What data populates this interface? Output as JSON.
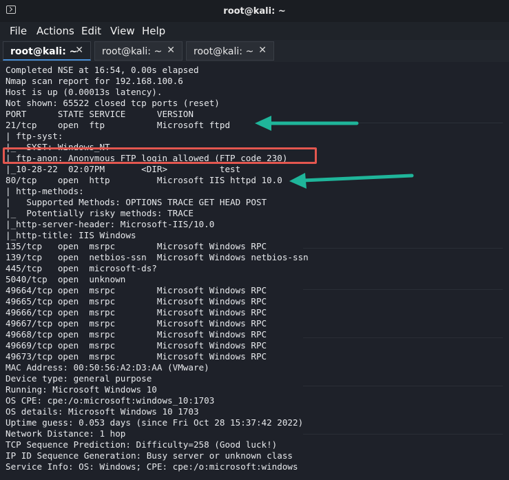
{
  "window": {
    "title": "root@kali: ~",
    "icon": "terminal-icon"
  },
  "menu": [
    "File",
    "Actions",
    "Edit",
    "View",
    "Help"
  ],
  "tabs": [
    {
      "label": "root@kali: ~",
      "close": "✕",
      "active": true
    },
    {
      "label": "root@kali: ~",
      "close": "✕",
      "active": false
    },
    {
      "label": "root@kali: ~",
      "close": "✕",
      "active": false
    }
  ],
  "terminal": {
    "lines": [
      "Completed NSE at 16:54, 0.00s elapsed",
      "Nmap scan report for 192.168.100.6",
      "Host is up (0.00013s latency).",
      "Not shown: 65522 closed tcp ports (reset)",
      "PORT      STATE SERVICE      VERSION",
      "21/tcp    open  ftp          Microsoft ftpd",
      "| ftp-syst:",
      "|_  SYST: Windows_NT",
      "| ftp-anon: Anonymous FTP login allowed (FTP code 230)",
      "|_10-28-22  02:07PM       <DIR>          test",
      "80/tcp    open  http         Microsoft IIS httpd 10.0",
      "| http-methods:",
      "|   Supported Methods: OPTIONS TRACE GET HEAD POST",
      "|_  Potentially risky methods: TRACE",
      "|_http-server-header: Microsoft-IIS/10.0",
      "|_http-title: IIS Windows",
      "135/tcp   open  msrpc        Microsoft Windows RPC",
      "139/tcp   open  netbios-ssn  Microsoft Windows netbios-ssn",
      "445/tcp   open  microsoft-ds?",
      "5040/tcp  open  unknown",
      "49664/tcp open  msrpc        Microsoft Windows RPC",
      "49665/tcp open  msrpc        Microsoft Windows RPC",
      "49666/tcp open  msrpc        Microsoft Windows RPC",
      "49667/tcp open  msrpc        Microsoft Windows RPC",
      "49668/tcp open  msrpc        Microsoft Windows RPC",
      "49669/tcp open  msrpc        Microsoft Windows RPC",
      "49673/tcp open  msrpc        Microsoft Windows RPC",
      "MAC Address: 00:50:56:A2:D3:AA (VMware)",
      "Device type: general purpose",
      "Running: Microsoft Windows 10",
      "OS CPE: cpe:/o:microsoft:windows_10:1703",
      "OS details: Microsoft Windows 10 1703",
      "Uptime guess: 0.053 days (since Fri Oct 28 15:37:42 2022)",
      "Network Distance: 1 hop",
      "TCP Sequence Prediction: Difficulty=258 (Good luck!)",
      "IP ID Sequence Generation: Busy server or unknown class",
      "Service Info: OS: Windows; CPE: cpe:/o:microsoft:windows"
    ]
  },
  "annotations": {
    "box_color": "#e4574f",
    "arrow_color": "#1fb59a"
  }
}
